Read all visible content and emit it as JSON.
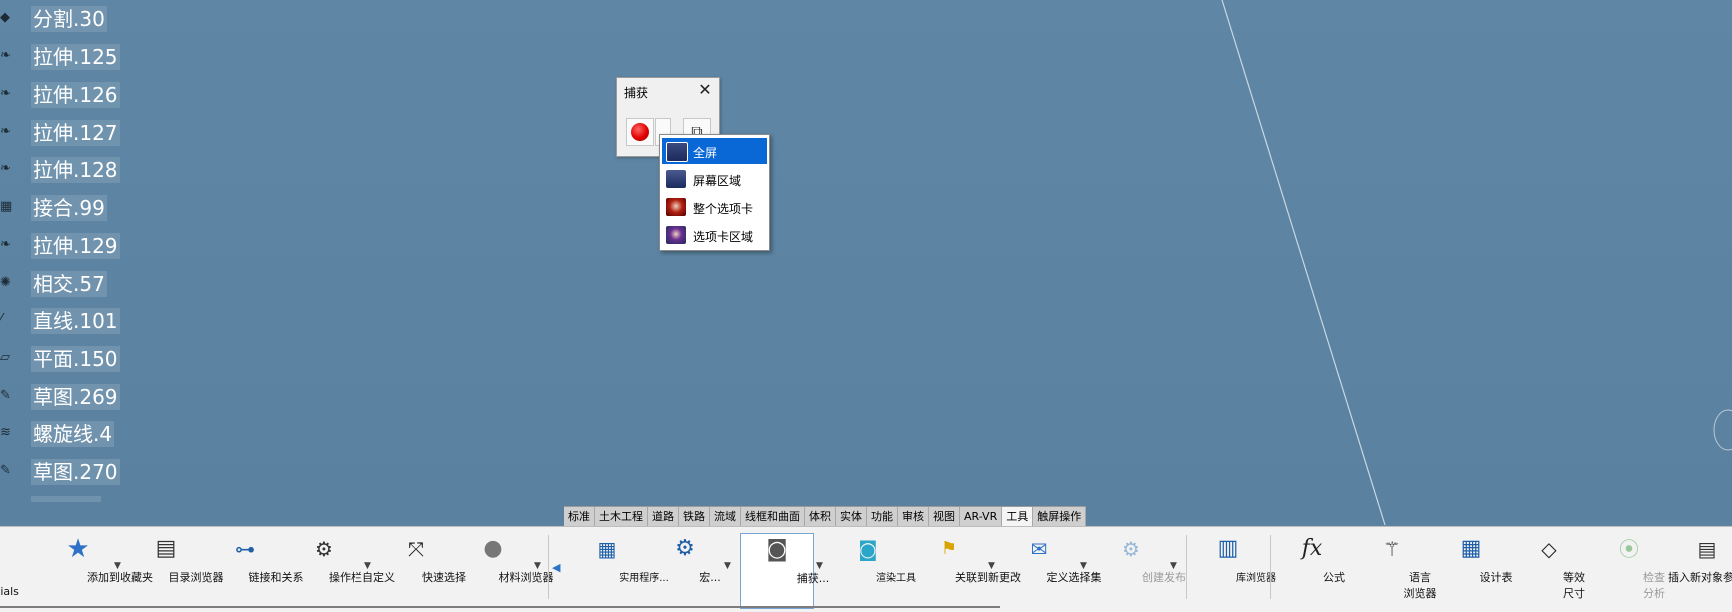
{
  "colors": {
    "viewport": "#5e86a4",
    "menu_highlight": "#0a68d6",
    "ribbon_bg": "#f2f2f2"
  },
  "tree": {
    "items": [
      {
        "label": "分割.30",
        "icon": "split-icon"
      },
      {
        "label": "拉伸.125",
        "icon": "extrude-icon"
      },
      {
        "label": "拉伸.126",
        "icon": "extrude-icon"
      },
      {
        "label": "拉伸.127",
        "icon": "extrude-icon"
      },
      {
        "label": "拉伸.128",
        "icon": "extrude-icon"
      },
      {
        "label": "接合.99",
        "icon": "join-icon"
      },
      {
        "label": "拉伸.129",
        "icon": "extrude-icon"
      },
      {
        "label": "相交.57",
        "icon": "intersect-icon"
      },
      {
        "label": "直线.101",
        "icon": "line-icon"
      },
      {
        "label": "平面.150",
        "icon": "plane-icon"
      },
      {
        "label": "草图.269",
        "icon": "sketch-icon"
      },
      {
        "label": "螺旋线.4",
        "icon": "helix-icon"
      },
      {
        "label": "草图.270",
        "icon": "sketch-icon"
      }
    ]
  },
  "capture_dialog": {
    "title": "捕获"
  },
  "capture_menu": {
    "items": [
      {
        "label": "全屏",
        "selected": true
      },
      {
        "label": "屏幕区域",
        "selected": false
      },
      {
        "label": "整个选项卡",
        "selected": false
      },
      {
        "label": "选项卡区域",
        "selected": false
      }
    ]
  },
  "tabs": [
    "标准",
    "土木工程",
    "道路",
    "铁路",
    "流域",
    "线框和曲面",
    "体积",
    "实体",
    "功能",
    "审核",
    "视图",
    "AR-VR",
    "工具",
    "触屏操作"
  ],
  "active_tab": "工具",
  "ribbon": {
    "cut_left_label": "tials",
    "items": {
      "favorites": "添加到收藏夹",
      "catalog": "目录浏览器",
      "links": "链接和关系",
      "customize": "操作栏自定义",
      "quick_select": "快速选择",
      "material": "材料浏览器",
      "utility": "实用程序...",
      "macro": "宏...",
      "capture": "捕获...",
      "render": "渲染工具",
      "link_update": "关联到新更改",
      "selection_set": "定义选择集",
      "publish": "创建发布",
      "library": "库浏览器",
      "formula": "公式",
      "lang_line1": "语言",
      "lang_line2": "浏览器",
      "design_table": "设计表",
      "iso_line1": "等效",
      "iso_line2": "尺寸",
      "check_line1": "检查",
      "check_line2": "分析",
      "insert_object": "插入新对象参"
    }
  }
}
